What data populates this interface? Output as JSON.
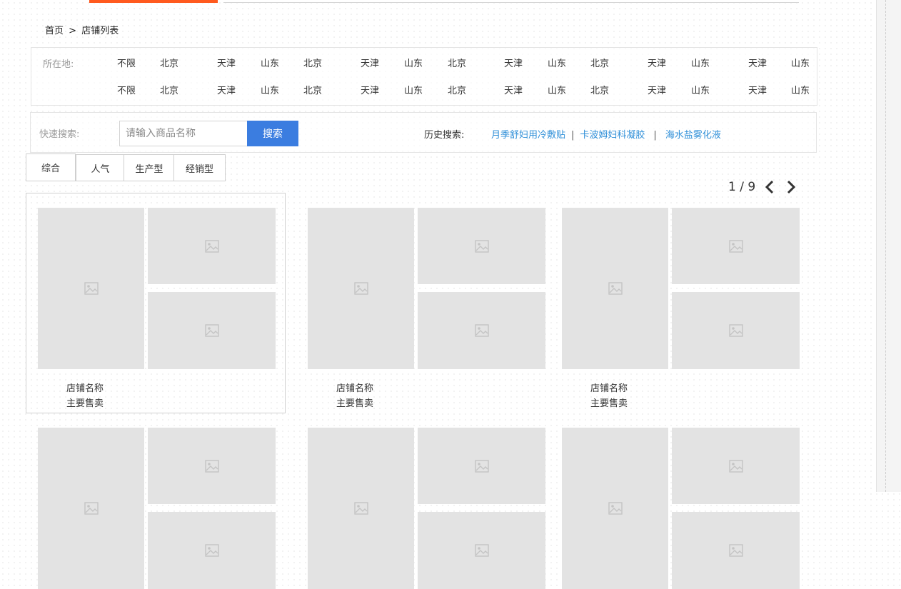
{
  "breadcrumb": {
    "home": "首页",
    "separator": ">",
    "current": "店铺列表"
  },
  "location_filter": {
    "label": "所在地:",
    "row1": [
      "不限",
      "北京",
      "天津",
      "山东",
      "北京",
      "天津",
      "山东",
      "北京",
      "天津",
      "山东",
      "北京",
      "天津",
      "山东",
      "天津",
      "山东"
    ],
    "row2": [
      "不限",
      "北京",
      "天津",
      "山东",
      "北京",
      "天津",
      "山东",
      "北京",
      "天津",
      "山东",
      "北京",
      "天津",
      "山东",
      "天津",
      "山东"
    ]
  },
  "search": {
    "label": "快速搜索:",
    "placeholder": "请输入商品名称",
    "value": "",
    "button": "搜索",
    "history_label": "历史搜索:",
    "history": [
      "月季舒妇用冷敷贴",
      "卡波姆妇科凝胶",
      "海水盐雾化液"
    ],
    "history_separator": "|"
  },
  "tabs": [
    "综合",
    "人气",
    "生产型",
    "经销型"
  ],
  "pager": {
    "text": "1 / 9",
    "prev_icon": "chevron-left-icon",
    "next_icon": "chevron-right-icon"
  },
  "cards": [
    {
      "name": "店铺名称",
      "sell": "主要售卖"
    },
    {
      "name": "店铺名称",
      "sell": "主要售卖"
    },
    {
      "name": "店铺名称",
      "sell": "主要售卖"
    },
    {
      "name": "",
      "sell": ""
    },
    {
      "name": "",
      "sell": ""
    },
    {
      "name": "",
      "sell": ""
    }
  ],
  "colors": {
    "accent": "#ff5a1f",
    "button": "#3b7de0",
    "link": "#2f8fd8",
    "placeholder_tile": "#e3e3e3"
  }
}
